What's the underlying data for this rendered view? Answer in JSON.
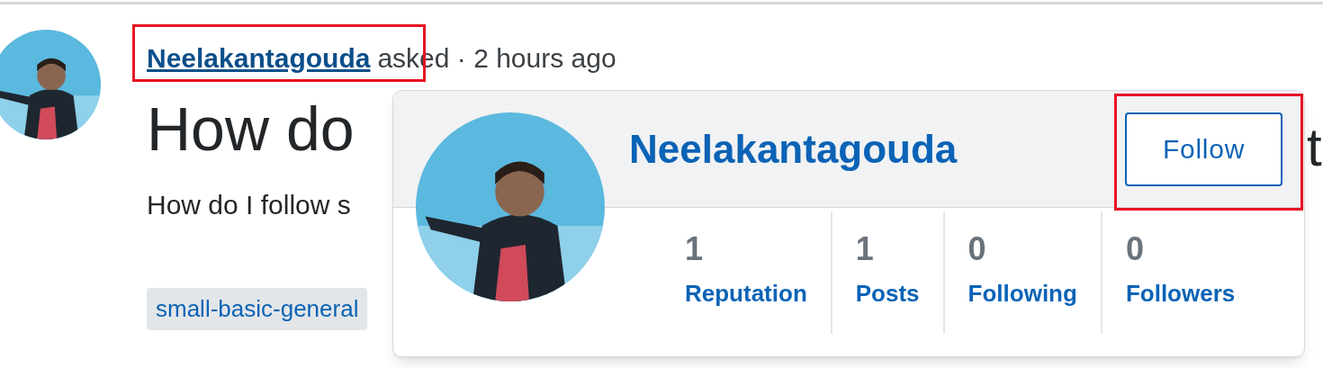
{
  "question": {
    "author": "Neelakantagouda",
    "meta": "asked · 2 hours ago",
    "title": "How do",
    "title_tail": "t",
    "body": "How do I follow s",
    "tags": [
      "small-basic-general"
    ]
  },
  "profile_card": {
    "name": "Neelakantagouda",
    "follow_button": "Follow",
    "stats": [
      {
        "value": "1",
        "label": "Reputation"
      },
      {
        "value": "1",
        "label": "Posts"
      },
      {
        "value": "0",
        "label": "Following"
      },
      {
        "value": "0",
        "label": "Followers"
      }
    ]
  }
}
